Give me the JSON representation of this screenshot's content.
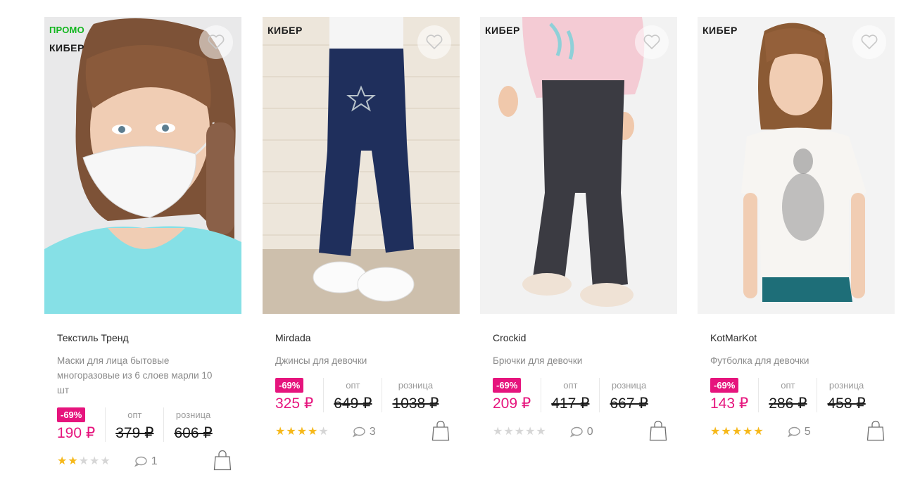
{
  "colors": {
    "accent": "#e6147d",
    "promo": "#12b61f",
    "star": "#f6b81a"
  },
  "products": [
    {
      "promo": "ПРОМО",
      "badge": "КИБЕР",
      "brand": "Текстиль Тренд",
      "title": "Маски для лица бытовые многоразовые из 6 слоев марли 10 шт",
      "discount": "-69%",
      "price": "190 ₽",
      "opt_label": "опт",
      "opt_price": "379 ₽",
      "retail_label": "розница",
      "retail_price": "606 ₽",
      "rating": 2,
      "comments": "1"
    },
    {
      "badge": "КИБЕР",
      "brand": "Mirdada",
      "title": "Джинсы для девочки",
      "discount": "-69%",
      "price": "325 ₽",
      "opt_label": "опт",
      "opt_price": "649 ₽",
      "retail_label": "розница",
      "retail_price": "1038 ₽",
      "rating": 4,
      "comments": "3"
    },
    {
      "badge": "КИБЕР",
      "brand": "Crockid",
      "title": "Брючки для девочки",
      "discount": "-69%",
      "price": "209 ₽",
      "opt_label": "опт",
      "opt_price": "417 ₽",
      "retail_label": "розница",
      "retail_price": "667 ₽",
      "rating": 0,
      "comments": "0"
    },
    {
      "badge": "КИБЕР",
      "brand": "KotMarKot",
      "title": "Футболка для девочки",
      "discount": "-69%",
      "price": "143 ₽",
      "opt_label": "опт",
      "opt_price": "286 ₽",
      "retail_label": "розница",
      "retail_price": "458 ₽",
      "rating": 5,
      "comments": "5"
    }
  ]
}
